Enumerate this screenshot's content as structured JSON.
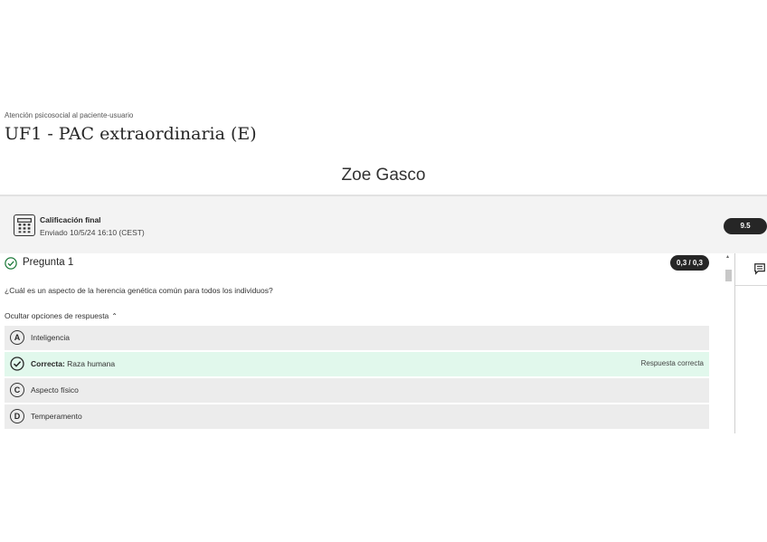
{
  "header": {
    "breadcrumb": "Atención psicosocial al paciente-usuario",
    "title": "UF1 - PAC extraordinaria (E)",
    "student": "Zoe Gasco"
  },
  "grade": {
    "label": "Calificación final",
    "submitted": "Enviado 10/5/24 16:10 (CEST)",
    "score": "9.5",
    "icon": "calculator-icon"
  },
  "question": {
    "title": "Pregunta 1",
    "score": "0,3 / 0,3",
    "text": "¿Cuál es un aspecto de la herencia genética común para todos los individuos?",
    "toggle_label": "Ocultar opciones de respuesta",
    "toggle_icon": "chevron-up-icon",
    "options": [
      {
        "letter": "A",
        "text": "Inteligencia",
        "correct": false
      },
      {
        "letter": "B",
        "prefix": "Correcta:",
        "text": "Raza humana",
        "correct": true,
        "feedback": "Respuesta correcta"
      },
      {
        "letter": "C",
        "text": "Aspecto físico",
        "correct": false
      },
      {
        "letter": "D",
        "text": "Temperamento",
        "correct": false
      }
    ]
  },
  "sidebar": {
    "icon": "comment-icon"
  },
  "colors": {
    "correct_bg": "#e1f8ec",
    "correct_icon": "#1d7a3a",
    "badge_bg": "#262626"
  }
}
